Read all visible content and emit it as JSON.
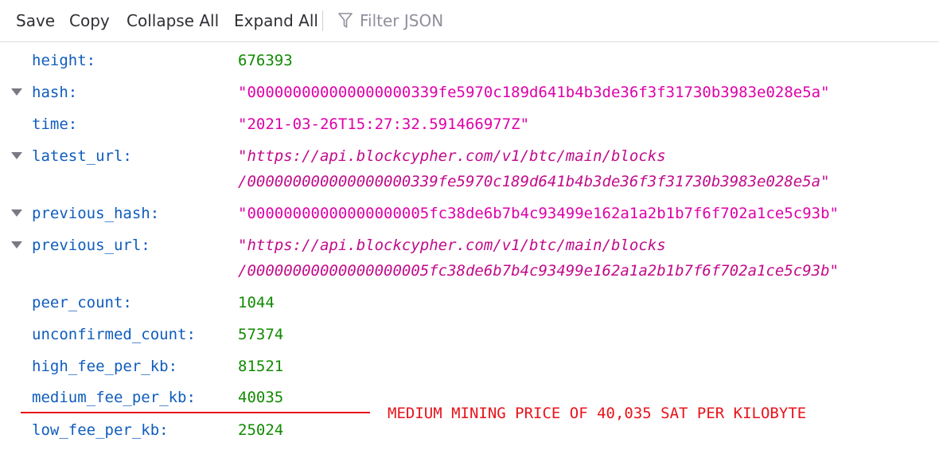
{
  "toolbar": {
    "save_label": "Save",
    "copy_label": "Copy",
    "collapse_all_label": "Collapse All",
    "expand_all_label": "Expand All",
    "filter_placeholder": "Filter JSON"
  },
  "json_rows": {
    "height": {
      "key": "height:",
      "value": "676393"
    },
    "hash": {
      "key": "hash:",
      "value": "\"000000000000000000339fe5970c189d641b4b3de36f3f31730b3983e028e5a\""
    },
    "time": {
      "key": "time:",
      "value": "\"2021-03-26T15:27:32.591466977Z\""
    },
    "latest_url": {
      "key": "latest_url:",
      "value_line1": "\"https://api.blockcypher.com/v1/btc/main/blocks",
      "value_line2": "/000000000000000000339fe5970c189d641b4b3de36f3f31730b3983e028e5a\""
    },
    "previous_hash": {
      "key": "previous_hash:",
      "value": "\"00000000000000000005fc38de6b7b4c93499e162a1a2b1b7f6f702a1ce5c93b\""
    },
    "previous_url": {
      "key": "previous_url:",
      "value_line1": "\"https://api.blockcypher.com/v1/btc/main/blocks",
      "value_line2": "/00000000000000000005fc38de6b7b4c93499e162a1a2b1b7f6f702a1ce5c93b\""
    },
    "peer_count": {
      "key": "peer_count:",
      "value": "1044"
    },
    "unconfirmed_count": {
      "key": "unconfirmed_count:",
      "value": "57374"
    },
    "high_fee_per_kb": {
      "key": "high_fee_per_kb:",
      "value": "81521"
    },
    "medium_fee_per_kb": {
      "key": "medium_fee_per_kb:",
      "value": "40035"
    },
    "low_fee_per_kb": {
      "key": "low_fee_per_kb:",
      "value": "25024"
    }
  },
  "annotation": {
    "text": "MEDIUM MINING PRICE OF 40,035 SAT PER KILOBYTE",
    "color": "#e8131b"
  },
  "colors": {
    "key": "#0f5dbd",
    "number": "#118a00",
    "string": "#dd00a9",
    "twisty": "#7a7a85"
  },
  "icons": {
    "filter": "funnel-icon",
    "expand_toggle": "triangle-down-icon"
  }
}
